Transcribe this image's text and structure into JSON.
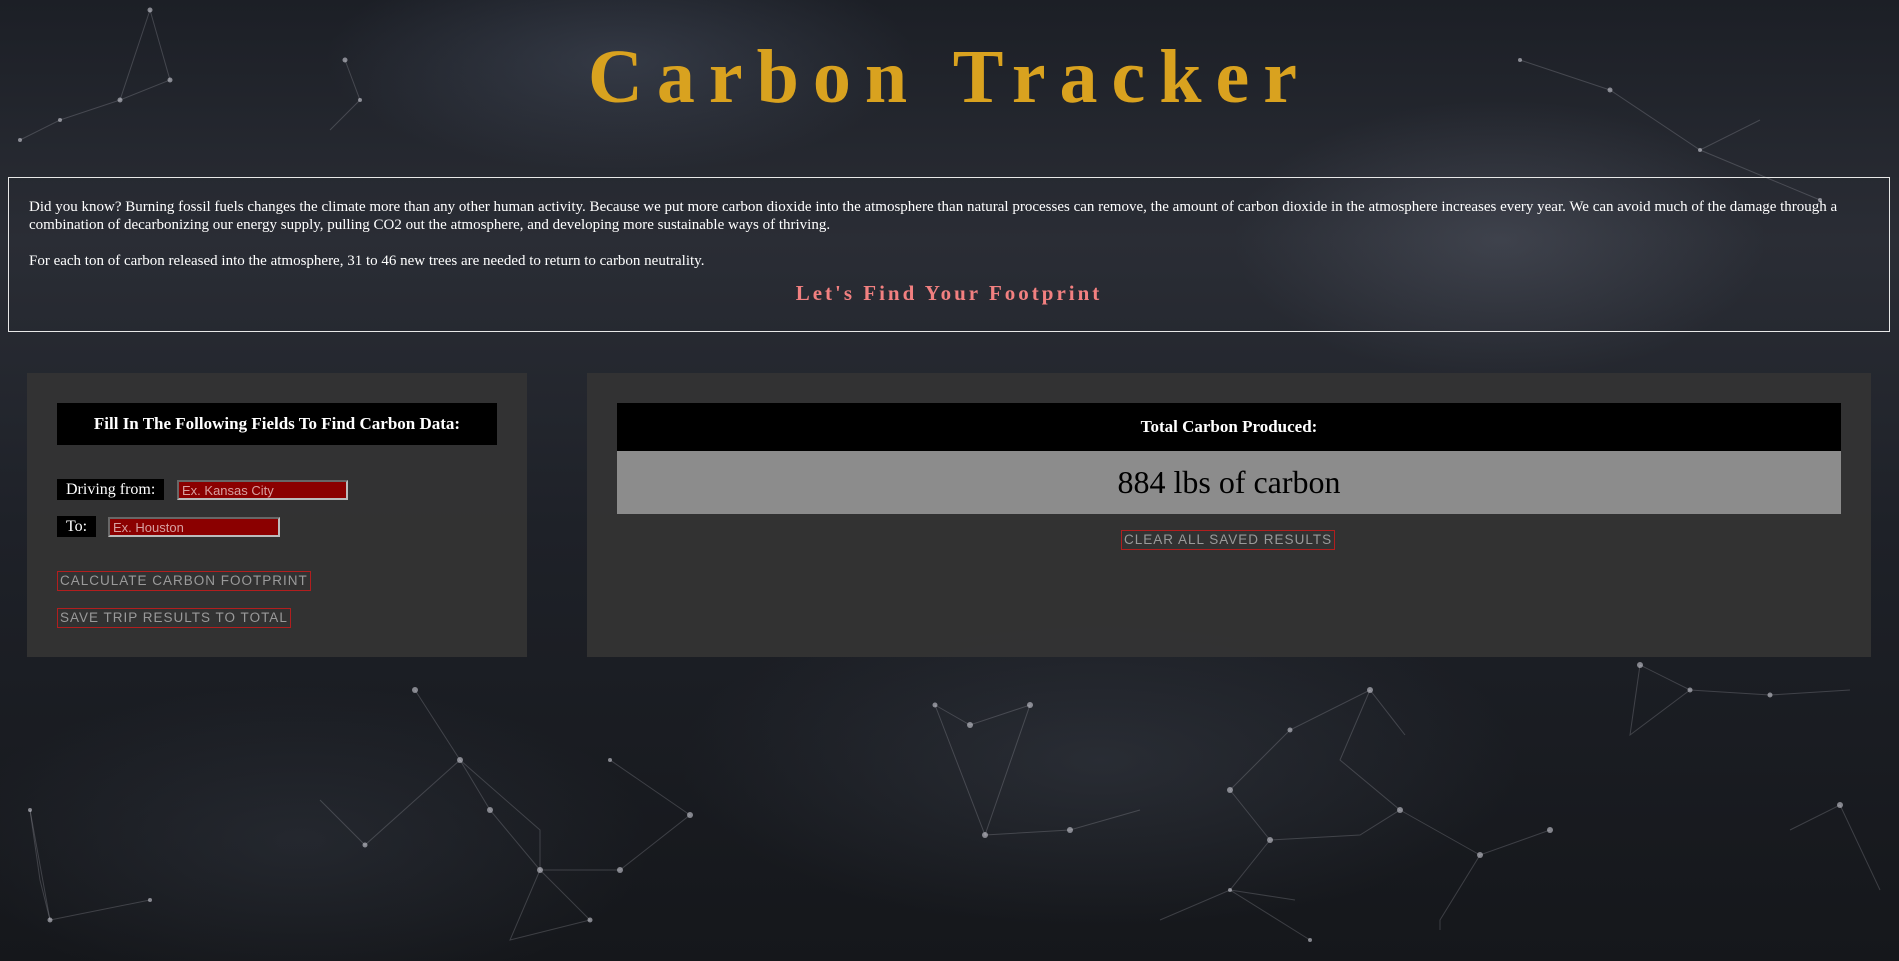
{
  "header": {
    "title": "Carbon Tracker"
  },
  "intro": {
    "paragraph_1": "Did you know? Burning fossil fuels changes the climate more than any other human activity. Because we put more carbon dioxide into the atmosphere than natural processes can remove, the amount of carbon dioxide in the atmosphere increases every year. We can avoid much of the damage through a combination of decarbonizing our energy supply, pulling CO2 out the atmosphere, and developing more sustainable ways of thriving.",
    "paragraph_2": "For each ton of carbon released into the atmosphere, 31 to 46 new trees are needed to return to carbon neutrality.",
    "cta": "Let's Find Your Footprint"
  },
  "form": {
    "heading": "Fill In The Following Fields To Find Carbon Data:",
    "from_label": "Driving from:",
    "from_placeholder": "Ex. Kansas City",
    "from_value": "",
    "to_label": "To:",
    "to_placeholder": "Ex. Houston",
    "to_value": "",
    "calculate_button": "Calculate Carbon Footprint",
    "save_button": "Save Trip Results to Total"
  },
  "results": {
    "heading": "Total Carbon Produced:",
    "total": "884 lbs of carbon",
    "clear_button": "Clear All Saved Results"
  },
  "colors": {
    "title": "#d9a21f",
    "cta": "#f28080",
    "input_background": "#8b0000",
    "button_border": "#b21e1e",
    "panel_background": "#343434"
  }
}
